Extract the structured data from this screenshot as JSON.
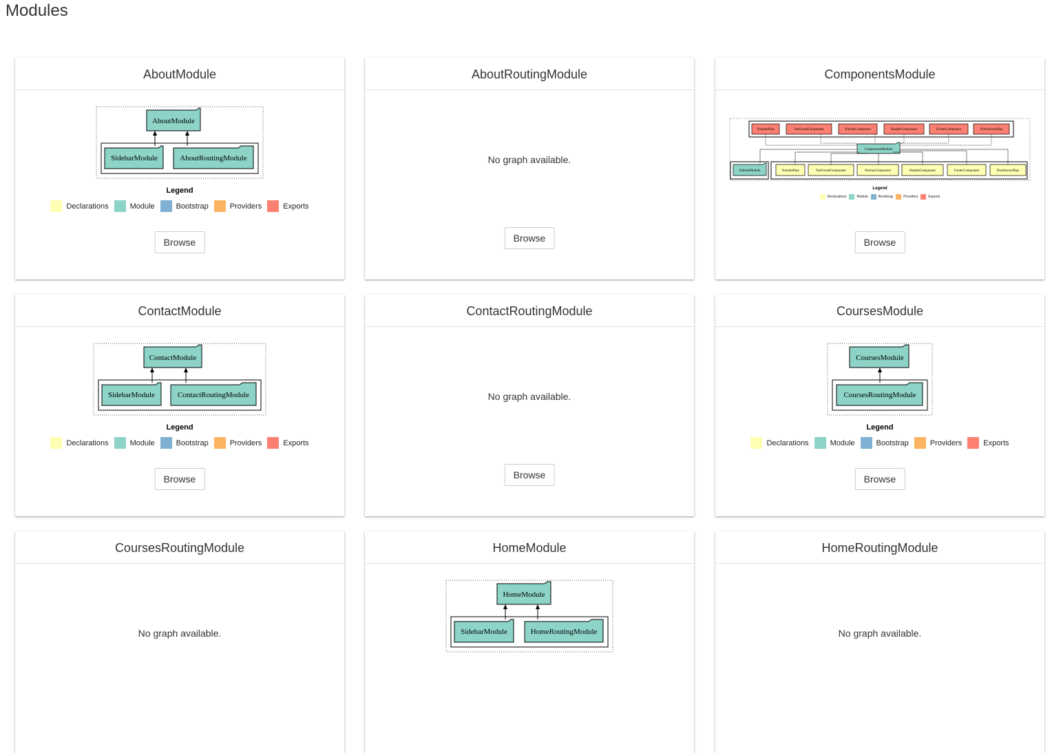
{
  "page_title": "Modules",
  "browse_label": "Browse",
  "no_graph_text": "No graph available.",
  "legend": {
    "title": "Legend",
    "items": [
      {
        "label": "Declarations",
        "color": "#ffffb3"
      },
      {
        "label": "Module",
        "color": "#8dd3c7"
      },
      {
        "label": "Bootstrap",
        "color": "#80b1d3"
      },
      {
        "label": "Providers",
        "color": "#fdb462"
      },
      {
        "label": "Exports",
        "color": "#fb8072"
      }
    ]
  },
  "modules": [
    {
      "name": "AboutModule",
      "node_main": "AboutModule",
      "imports": [
        "SidebarModule",
        "AboutRoutingModule"
      ]
    },
    {
      "name": "AboutRoutingModule"
    },
    {
      "name": "ComponentsModule",
      "node_main": "ComponentsModule",
      "exports": [
        "YoutubePipe",
        "NotFoundComponent",
        "NavbarComponent",
        "HeaderComponent",
        "FooterComponent",
        "DomSecurePipe"
      ],
      "imports": [
        "SidebarModule"
      ],
      "declarations": [
        "YoutubePipe",
        "NotFoundComponent",
        "NavbarComponent",
        "HeaderComponent",
        "FooterComponent",
        "DomSecurePipe"
      ]
    },
    {
      "name": "ContactModule",
      "node_main": "ContactModule",
      "imports": [
        "SidebarModule",
        "ContactRoutingModule"
      ]
    },
    {
      "name": "ContactRoutingModule"
    },
    {
      "name": "CoursesModule",
      "node_main": "CoursesModule",
      "imports": [
        "CoursesRoutingModule"
      ]
    },
    {
      "name": "CoursesRoutingModule"
    },
    {
      "name": "HomeModule",
      "node_main": "HomeModule",
      "imports": [
        "SidebarModule",
        "HomeRoutingModule"
      ]
    },
    {
      "name": "HomeRoutingModule"
    }
  ]
}
